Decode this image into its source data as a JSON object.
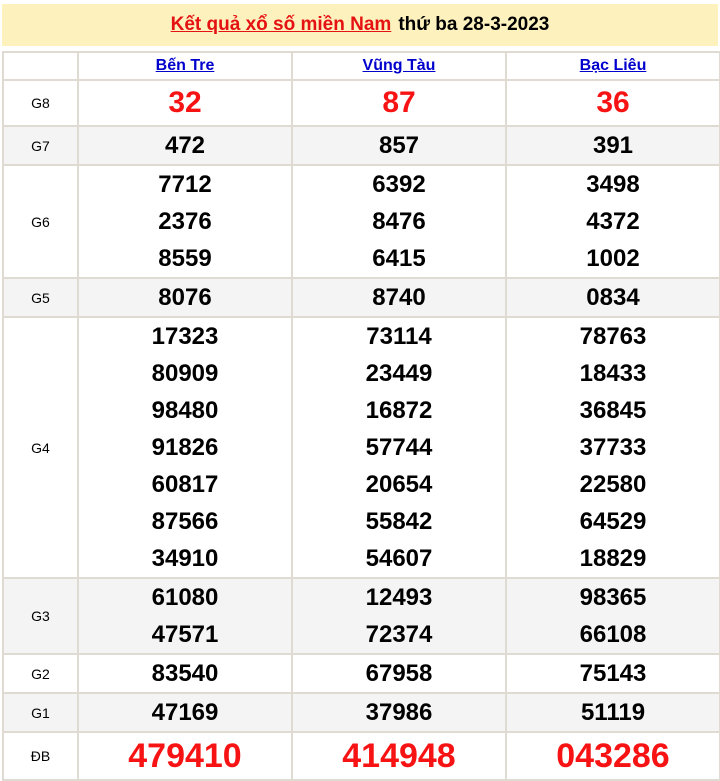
{
  "header": {
    "title_link": "Kết quả xổ số miền Nam",
    "title_date": "thứ ba 28-3-2023"
  },
  "results": {
    "columns": [
      "Bến Tre",
      "Vũng Tàu",
      "Bạc Liêu"
    ],
    "prizes": [
      {
        "label": "G8",
        "values": [
          [
            "32"
          ],
          [
            "87"
          ],
          [
            "36"
          ]
        ]
      },
      {
        "label": "G7",
        "values": [
          [
            "472"
          ],
          [
            "857"
          ],
          [
            "391"
          ]
        ]
      },
      {
        "label": "G6",
        "values": [
          [
            "7712",
            "2376",
            "8559"
          ],
          [
            "6392",
            "8476",
            "6415"
          ],
          [
            "3498",
            "4372",
            "1002"
          ]
        ]
      },
      {
        "label": "G5",
        "values": [
          [
            "8076"
          ],
          [
            "8740"
          ],
          [
            "0834"
          ]
        ]
      },
      {
        "label": "G4",
        "values": [
          [
            "17323",
            "80909",
            "98480",
            "91826",
            "60817",
            "87566",
            "34910"
          ],
          [
            "73114",
            "23449",
            "16872",
            "57744",
            "20654",
            "55842",
            "54607"
          ],
          [
            "78763",
            "18433",
            "36845",
            "37733",
            "22580",
            "64529",
            "18829"
          ]
        ]
      },
      {
        "label": "G3",
        "values": [
          [
            "61080",
            "47571"
          ],
          [
            "12493",
            "72374"
          ],
          [
            "98365",
            "66108"
          ]
        ]
      },
      {
        "label": "G2",
        "values": [
          [
            "83540"
          ],
          [
            "67958"
          ],
          [
            "75143"
          ]
        ]
      },
      {
        "label": "G1",
        "values": [
          [
            "47169"
          ],
          [
            "37986"
          ],
          [
            "51119"
          ]
        ]
      },
      {
        "label": "ĐB",
        "values": [
          [
            "479410"
          ],
          [
            "414948"
          ],
          [
            "043286"
          ]
        ]
      }
    ]
  },
  "colors": {
    "title_band_yellow": "#fdf1be",
    "accent_red": "#f71313",
    "link_blue": "#0000cc",
    "row_alt_gray": "#f4f4f4",
    "table_border": "#e0dbd2"
  }
}
